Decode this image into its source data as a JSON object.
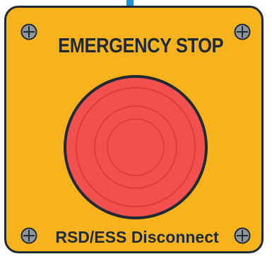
{
  "panel": {
    "title": "EMERGENCY STOP",
    "footer_label": "RSD/ESS Disconnect",
    "colors": {
      "panel": "#f7b21c",
      "border": "#1f2a33",
      "button": "#f2504f",
      "cable": "#1e90d6"
    }
  },
  "icons": {
    "screw": "screw-icon",
    "button": "emergency-stop-button"
  }
}
